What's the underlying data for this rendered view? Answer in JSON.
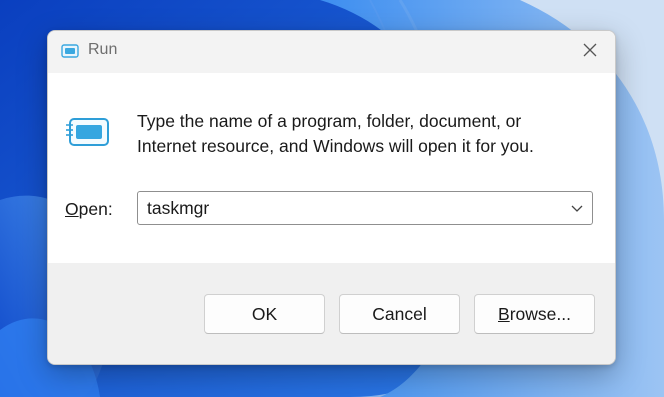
{
  "dialog": {
    "title": "Run",
    "close_label": "×",
    "description_line1": "Type the name of a program, folder, document, or",
    "description_line2": "Internet resource, and Windows will open it for you.",
    "open_label_accel": "O",
    "open_label_rest": "pen:",
    "open_value": "taskmgr"
  },
  "buttons": {
    "ok": "OK",
    "cancel": "Cancel",
    "browse_accel": "B",
    "browse_rest": "rowse..."
  },
  "colors": {
    "accent": "#1e63d8",
    "icon_blue": "#3aa8e0",
    "titlebar": "#f3f3f3",
    "footer": "#f0f0f0"
  },
  "icons": {
    "title": "run-icon",
    "close": "close-icon",
    "main": "run-icon",
    "dropdown": "chevron-down-icon"
  }
}
